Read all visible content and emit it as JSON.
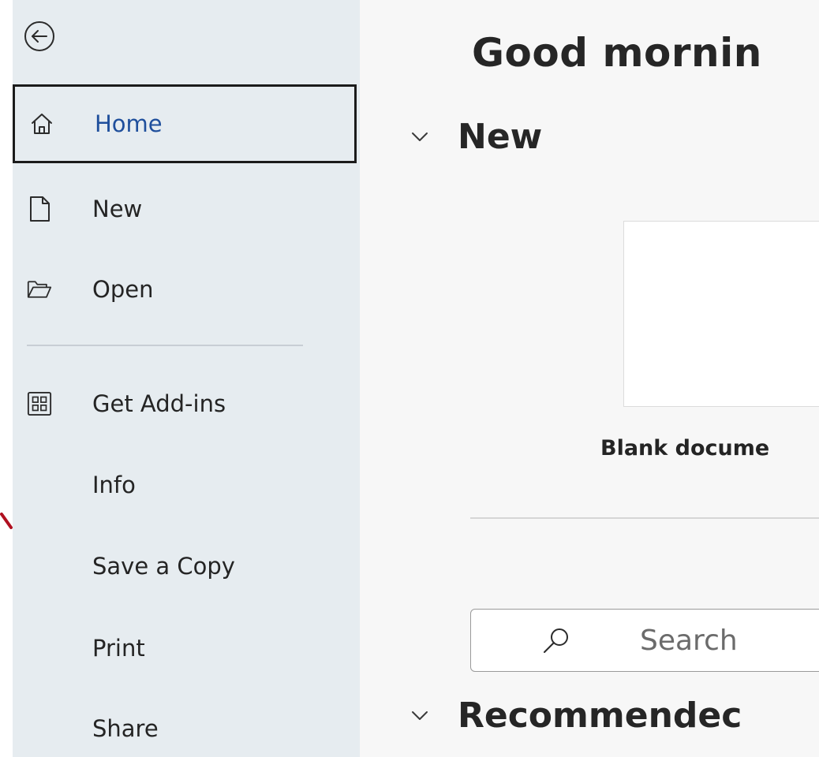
{
  "sidebar": {
    "back_icon": "back-arrow-circle-icon",
    "items": [
      {
        "label": "Home",
        "icon": "home-icon",
        "active": true
      },
      {
        "label": "New",
        "icon": "new-document-icon"
      },
      {
        "label": "Open",
        "icon": "open-folder-icon"
      },
      {
        "label": "Get Add-ins",
        "icon": "add-ins-grid-icon"
      },
      {
        "label": "Info"
      },
      {
        "label": "Save a Copy"
      },
      {
        "label": "Print"
      },
      {
        "label": "Share"
      }
    ]
  },
  "main": {
    "greeting": "Good mornin",
    "new_section": {
      "title": "New",
      "templates": [
        {
          "label": "Blank docume"
        }
      ]
    },
    "search": {
      "placeholder": "Search",
      "icon": "search-icon"
    },
    "recommended_section": {
      "title": "Recommendec"
    }
  },
  "colors": {
    "sidebar_bg": "#e6ecf0",
    "main_bg": "#f7f7f7",
    "active_label": "#1f4f9c",
    "annotation": "#b01020"
  }
}
